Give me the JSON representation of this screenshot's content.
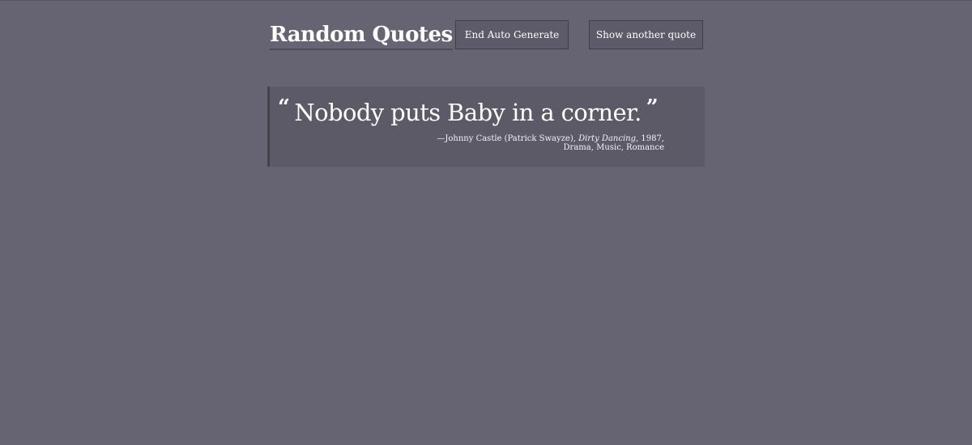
{
  "header": {
    "title": "Random Quotes",
    "buttons": {
      "auto_generate": "End Auto Generate",
      "next_quote": "Show another quote"
    }
  },
  "quote": {
    "open_mark": "“",
    "text": "Nobody puts Baby in a corner.",
    "close_mark": "”",
    "citation": {
      "dash": "—",
      "character": "Johnny Castle (Patrick Swayze),",
      "film": "Dirty Dancing",
      "year": ", 1987,",
      "genres": "Drama, Music, Romance"
    }
  },
  "colors": {
    "background": "#666373",
    "quote_panel": "#5d5a68",
    "button_bg": "#5d5a69",
    "text": "#ffffff"
  }
}
